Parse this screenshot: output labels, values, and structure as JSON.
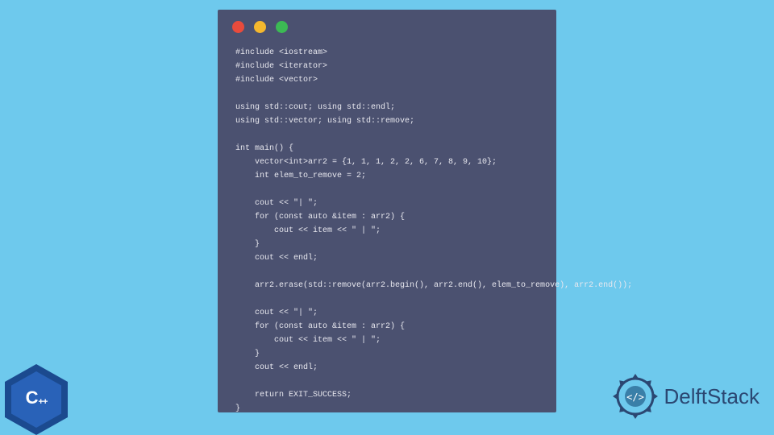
{
  "code": "#include <iostream>\n#include <iterator>\n#include <vector>\n\nusing std::cout; using std::endl;\nusing std::vector; using std::remove;\n\nint main() {\n    vector<int>arr2 = {1, 1, 1, 2, 2, 6, 7, 8, 9, 10};\n    int elem_to_remove = 2;\n\n    cout << \"| \";\n    for (const auto &item : arr2) {\n        cout << item << \" | \";\n    }\n    cout << endl;\n\n    arr2.erase(std::remove(arr2.begin(), arr2.end(), elem_to_remove), arr2.end());\n\n    cout << \"| \";\n    for (const auto &item : arr2) {\n        cout << item << \" | \";\n    }\n    cout << endl;\n\n    return EXIT_SUCCESS;\n}",
  "cpp_logo": {
    "letter": "C",
    "plus": "++"
  },
  "brand": {
    "name": "DelftStack"
  }
}
